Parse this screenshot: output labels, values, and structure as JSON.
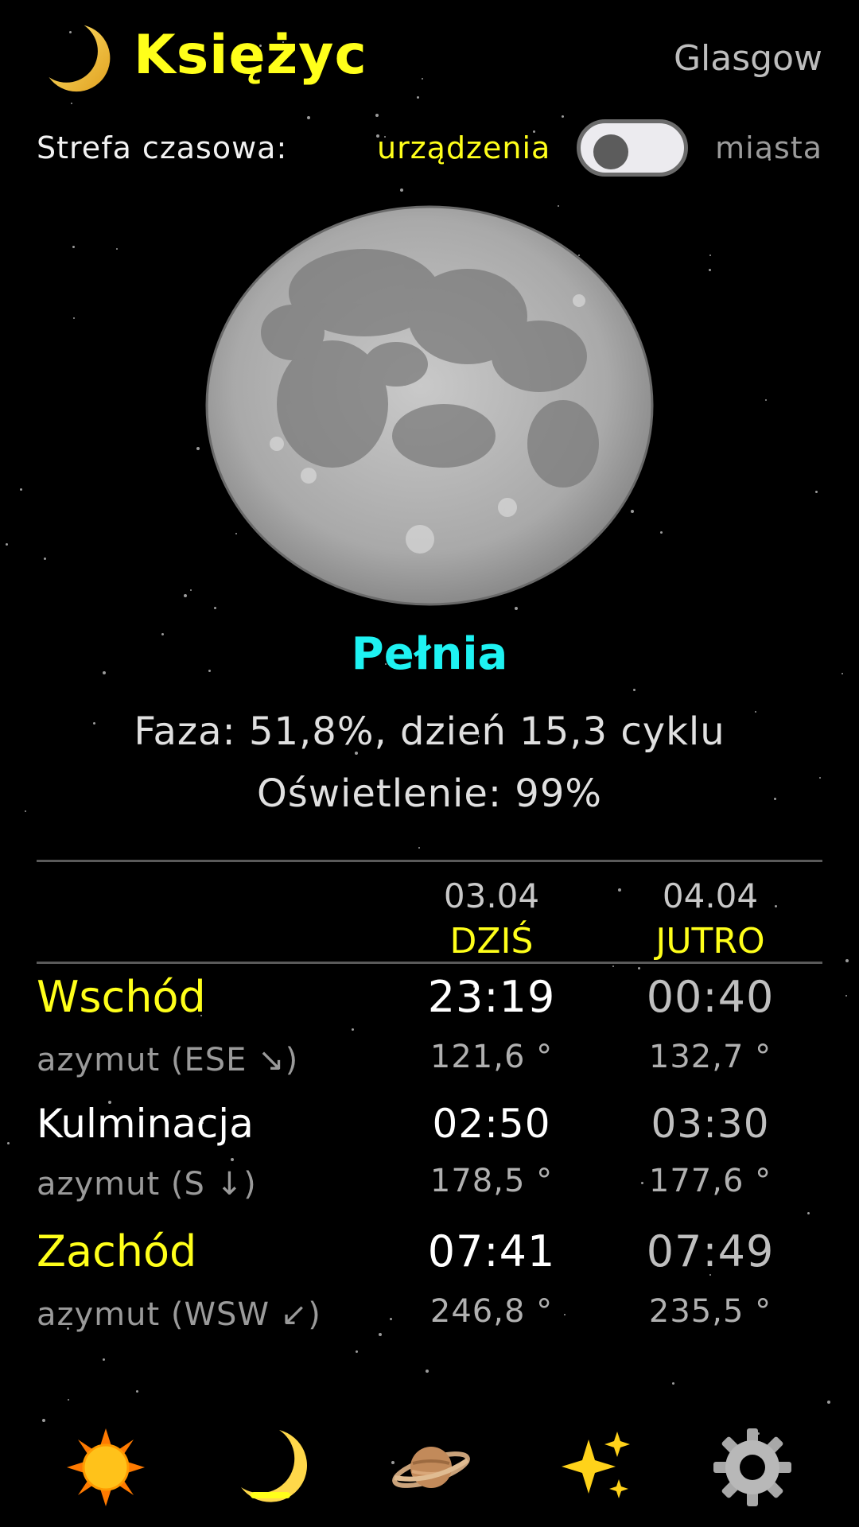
{
  "header": {
    "title": "Księżyc",
    "city": "Glasgow",
    "icon": "crescent-moon-icon"
  },
  "timezone": {
    "label": "Strefa czasowa:",
    "device_label": "urządzenia",
    "city_label": "miasta",
    "toggle_state": "off"
  },
  "moon": {
    "phase_name": "Pełnia",
    "phase_info": "Faza: 51,8%, dzień 15,3 cyklu",
    "illumination": "Oświetlenie: 99%"
  },
  "table": {
    "columns": [
      {
        "date": "03.04",
        "day": "DZIŚ"
      },
      {
        "date": "04.04",
        "day": "JUTRO"
      }
    ],
    "rows": [
      {
        "label": "Wschód",
        "label_color": "#ffff1a",
        "azimuth_label": "azymut (ESE ↘)",
        "times": [
          "23:19",
          "00:40"
        ],
        "azimuths": [
          "121,6 °",
          "132,7 °"
        ]
      },
      {
        "label": "Kulminacja",
        "label_color": "#ffffff",
        "azimuth_label": "azymut (S ↓)",
        "times": [
          "02:50",
          "03:30"
        ],
        "azimuths": [
          "178,5 °",
          "177,6 °"
        ]
      },
      {
        "label": "Zachód",
        "label_color": "#ffff1a",
        "azimuth_label": "azymut (WSW ↙)",
        "times": [
          "07:41",
          "07:49"
        ],
        "azimuths": [
          "246,8 °",
          "235,5 °"
        ]
      }
    ]
  },
  "nav": {
    "items": [
      "sun-icon",
      "moon-icon",
      "planet-icon",
      "sparkles-icon",
      "gear-icon"
    ],
    "active": "moon-icon"
  },
  "colors": {
    "accent": "#ffff1a",
    "phase": "#1ef2f2",
    "background": "#000000"
  }
}
